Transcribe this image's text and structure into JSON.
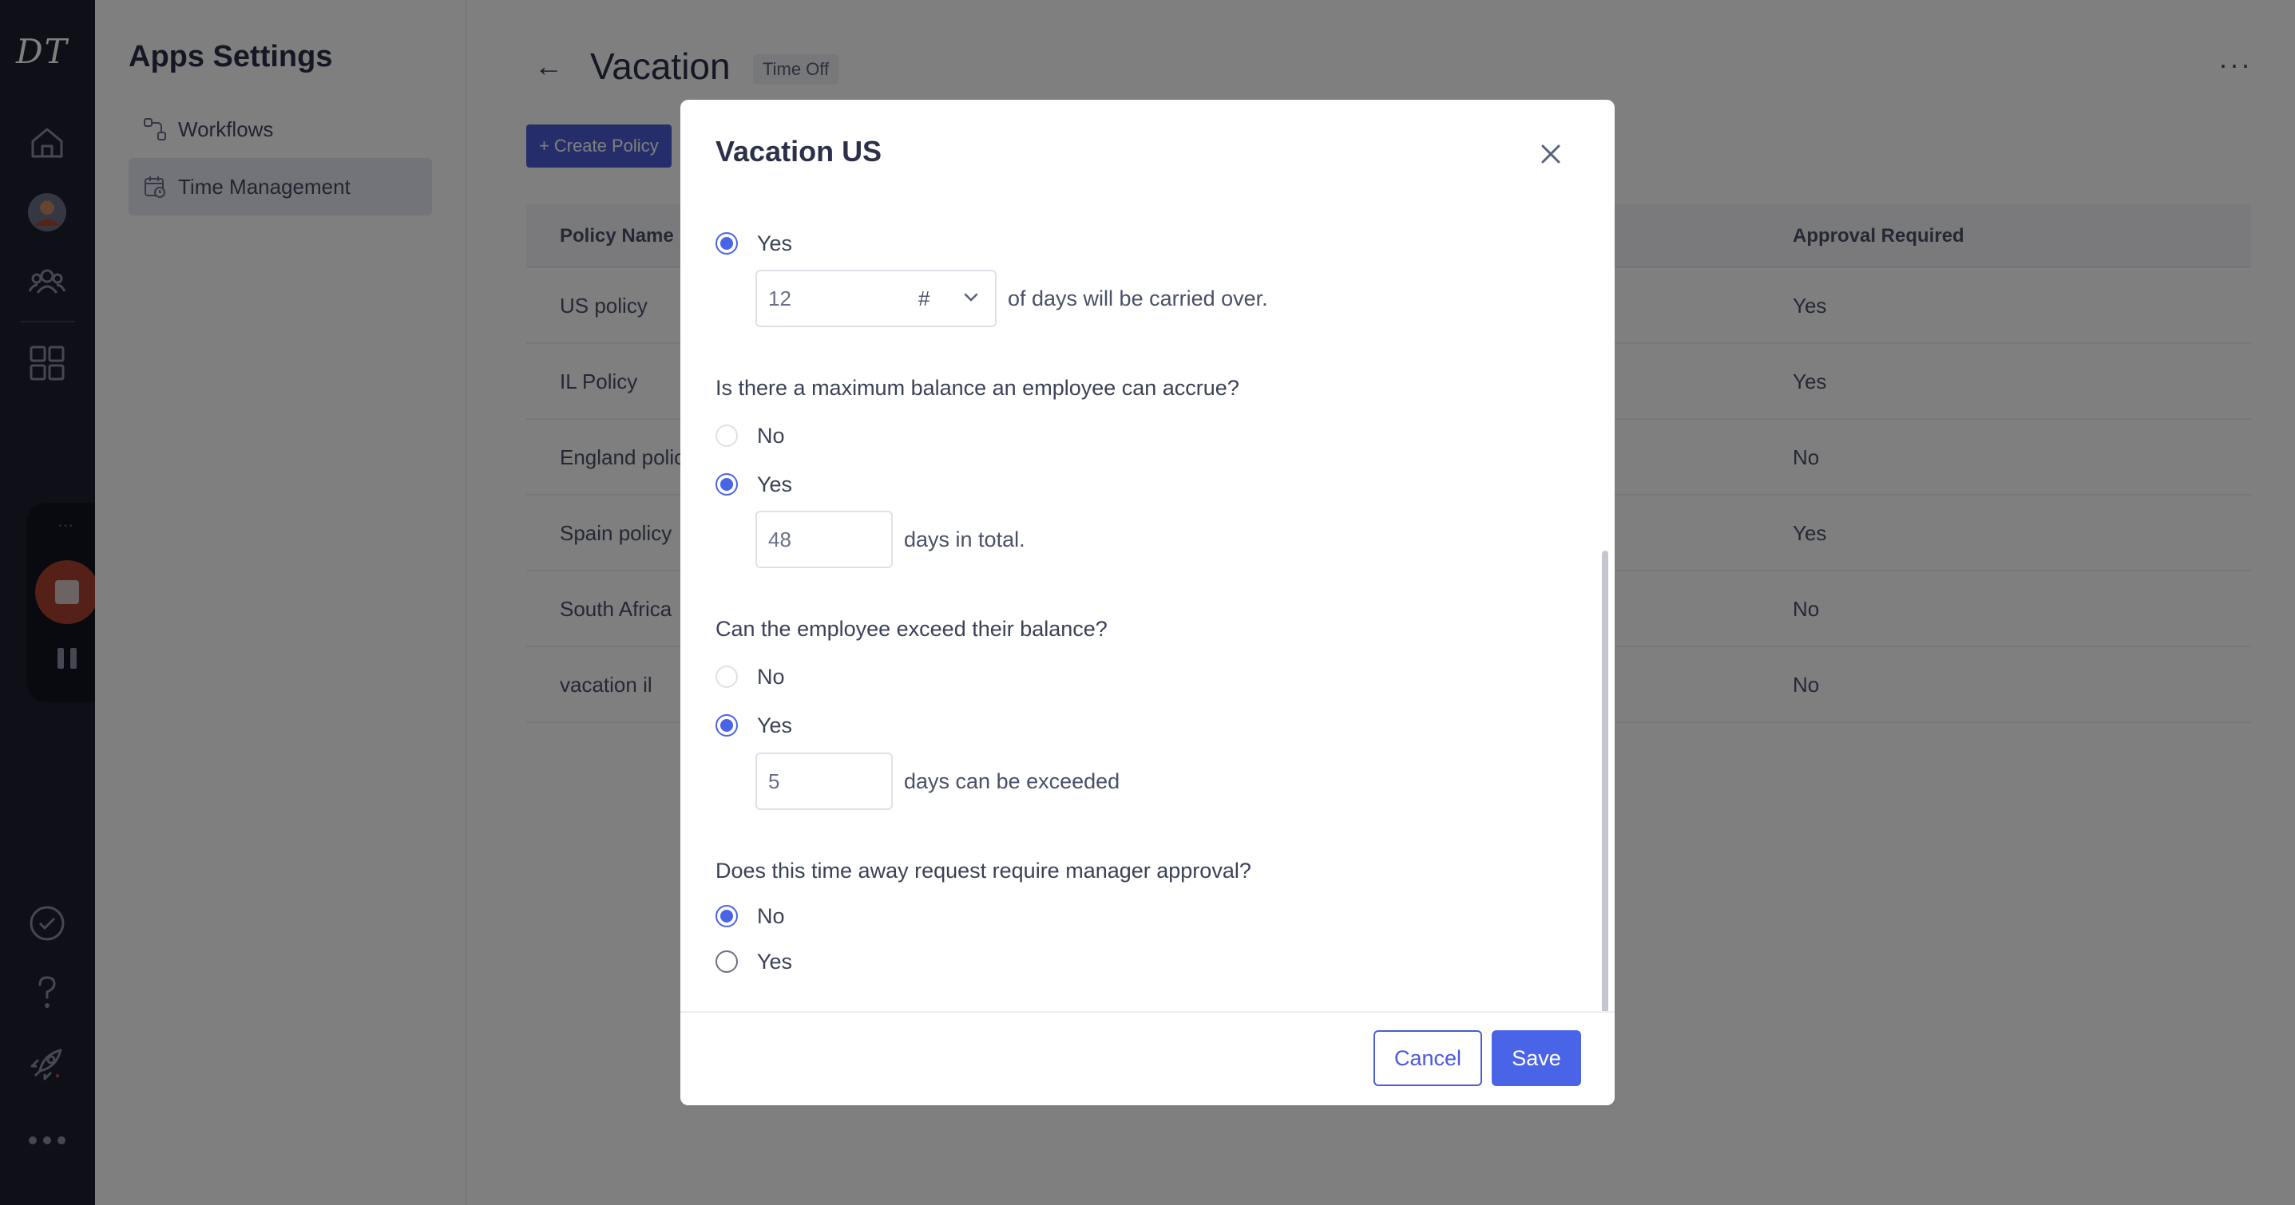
{
  "app": {
    "logo_text": "DT"
  },
  "rail": {
    "icons": [
      "home-icon",
      "avatar",
      "people-icon",
      "apps-grid-icon",
      "check-circle-icon",
      "help-icon",
      "rocket-icon",
      "more-horizontal-icon"
    ]
  },
  "recorder": {
    "dots": "⋯"
  },
  "settings": {
    "title": "Apps Settings",
    "nav": [
      {
        "label": "Workflows",
        "icon": "workflow-icon",
        "active": false
      },
      {
        "label": "Time Management",
        "icon": "calendar-icon",
        "active": true
      }
    ]
  },
  "page": {
    "back_glyph": "←",
    "title": "Vacation",
    "badge": "Time Off",
    "more_glyph": "···",
    "create_button": "Create Policy",
    "columns": {
      "policy_name": "Policy Name",
      "approval_required": "Approval Required"
    },
    "rows": [
      {
        "name": "US policy",
        "approval": "Yes"
      },
      {
        "name": "IL Policy",
        "approval": "Yes"
      },
      {
        "name": "England polic",
        "approval": "No"
      },
      {
        "name": "Spain policy",
        "approval": "Yes"
      },
      {
        "name": "South Africa",
        "approval": "No"
      },
      {
        "name": "vacation il",
        "approval": "No"
      }
    ]
  },
  "modal": {
    "title": "Vacation US",
    "carryover": {
      "yes_label": "Yes",
      "value": "12",
      "unit": "#",
      "suffix": "of days will be carried over."
    },
    "max_balance": {
      "question": "Is there a maximum balance an employee can accrue?",
      "no_label": "No",
      "yes_label": "Yes",
      "selected": "Yes",
      "value": "48",
      "suffix": "days in total."
    },
    "exceed_balance": {
      "question": "Can the employee exceed their balance?",
      "no_label": "No",
      "yes_label": "Yes",
      "selected": "Yes",
      "value": "5",
      "suffix": "days can be exceeded"
    },
    "manager_approval": {
      "question": "Does this time away request require manager approval?",
      "no_label": "No",
      "yes_label": "Yes",
      "selected": "No"
    },
    "cancel_label": "Cancel",
    "save_label": "Save"
  },
  "colors": {
    "accent": "#4a64e8",
    "rail_bg": "#1c1f2e",
    "recorder_stop": "#a8402e"
  }
}
